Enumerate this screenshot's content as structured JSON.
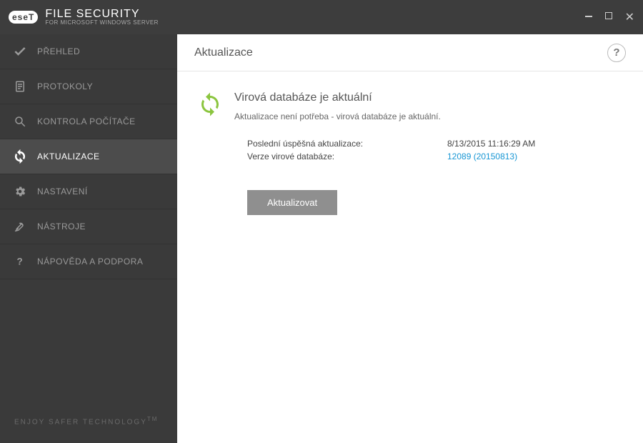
{
  "titlebar": {
    "logo_text": "eseT",
    "product_main": "FILE SECURITY",
    "product_sub": "FOR MICROSOFT WINDOWS SERVER"
  },
  "sidebar": {
    "items": [
      {
        "label": "PŘEHLED"
      },
      {
        "label": "PROTOKOLY"
      },
      {
        "label": "KONTROLA POČÍTAČE"
      },
      {
        "label": "AKTUALIZACE"
      },
      {
        "label": "NASTAVENÍ"
      },
      {
        "label": "NÁSTROJE"
      },
      {
        "label": "NÁPOVĚDA A PODPORA"
      }
    ],
    "footer": "ENJOY SAFER TECHNOLOGY",
    "footer_tm": "TM"
  },
  "main": {
    "header_title": "Aktualizace",
    "help_symbol": "?",
    "status_title": "Virová databáze je aktuální",
    "status_subtitle": "Aktualizace není potřeba - virová databáze je aktuální.",
    "details": {
      "last_update_label": "Poslední úspěšná aktualizace:",
      "last_update_value": "8/13/2015 11:16:29 AM",
      "db_version_label": "Verze virové databáze:",
      "db_version_value": "12089 (20150813)"
    },
    "update_button": "Aktualizovat"
  }
}
